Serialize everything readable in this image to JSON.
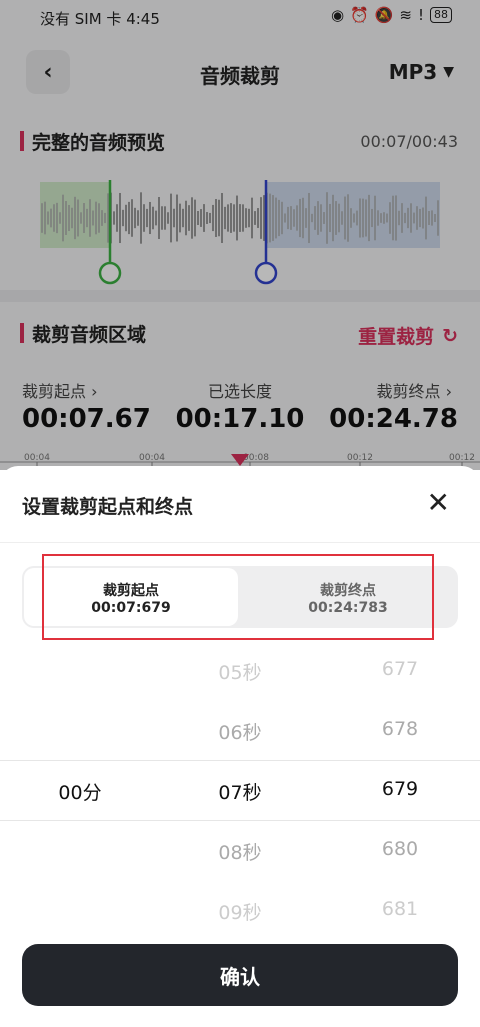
{
  "status": {
    "carrier_time": "没有 SIM 卡 4:45",
    "battery": "88"
  },
  "header": {
    "title": "音频裁剪",
    "format": "MP3"
  },
  "preview": {
    "title": "完整的音频预览",
    "time": "00:07/00:43"
  },
  "trim": {
    "title": "裁剪音频区域",
    "reset": "重置裁剪",
    "start_label": "裁剪起点 ›",
    "start_value": "00:07.67",
    "len_label": "已选长度",
    "len_value": "00:17.10",
    "end_label": "裁剪终点 ›",
    "end_value": "00:24.78"
  },
  "ruler_labels": [
    "00:04",
    "00:04",
    "00:08",
    "00:12",
    "00:12"
  ],
  "sheet": {
    "title": "设置裁剪起点和终点",
    "start_tab": {
      "label": "裁剪起点",
      "value": "00:07:679"
    },
    "end_tab": {
      "label": "裁剪终点",
      "value": "00:24:783"
    },
    "minutes": {
      "selected": "00分"
    },
    "seconds": [
      "05秒",
      "06秒",
      "07秒",
      "08秒",
      "09秒"
    ],
    "millis": [
      "677",
      "678",
      "679",
      "680",
      "681"
    ],
    "confirm": "确认"
  },
  "colors": {
    "accent": "#d9315c",
    "start_marker": "#3cb043",
    "end_marker": "#3344cc",
    "highlight": "#e0313c"
  }
}
